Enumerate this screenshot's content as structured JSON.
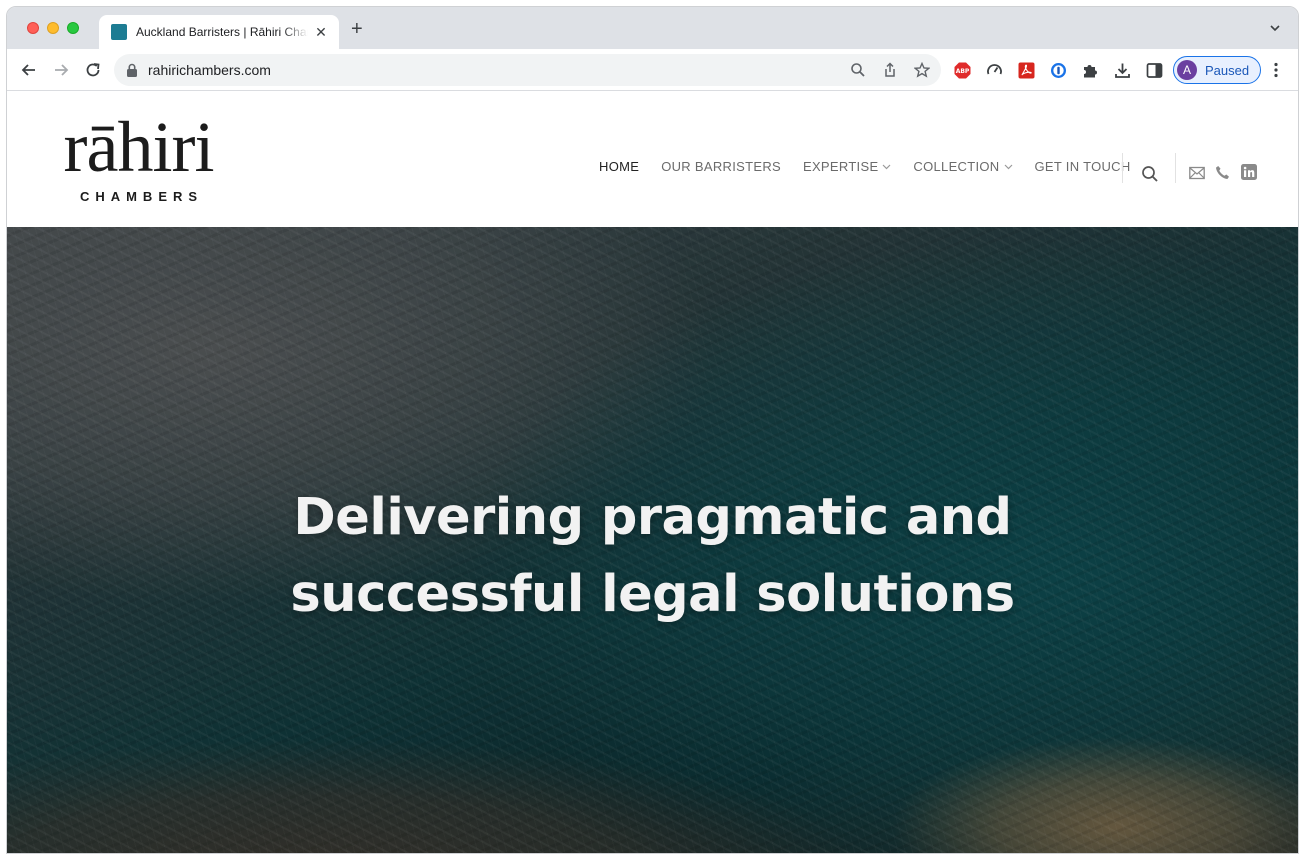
{
  "browser": {
    "tab_title": "Auckland Barristers | Rāhiri Chambers",
    "tab_close": "✕",
    "new_tab": "+",
    "url": "rahirichambers.com",
    "profile_initial": "A",
    "profile_label": "Paused",
    "extensions": [
      "abp-icon",
      "speedometer-icon",
      "pdf-icon",
      "password-manager-icon",
      "puzzle-icon",
      "download-icon",
      "side-panel-icon"
    ]
  },
  "site": {
    "logo_word": "rāhiri",
    "logo_sub": "CHAMBERS",
    "nav": [
      {
        "label": "HOME",
        "active": true
      },
      {
        "label": "OUR BARRISTERS"
      },
      {
        "label": "EXPERTISE",
        "dropdown": true
      },
      {
        "label": "COLLECTION",
        "dropdown": true
      },
      {
        "label": "GET IN TOUCH"
      }
    ],
    "header_icons": [
      "search-icon",
      "mail-icon",
      "phone-icon",
      "linkedin-icon"
    ]
  },
  "hero": {
    "line1": "Delivering pragmatic and",
    "line2": "successful legal solutions"
  },
  "colors": {
    "accent": "#1a73e8",
    "favicon": "#1d7c93",
    "hero_text": "#f2f2f2"
  }
}
